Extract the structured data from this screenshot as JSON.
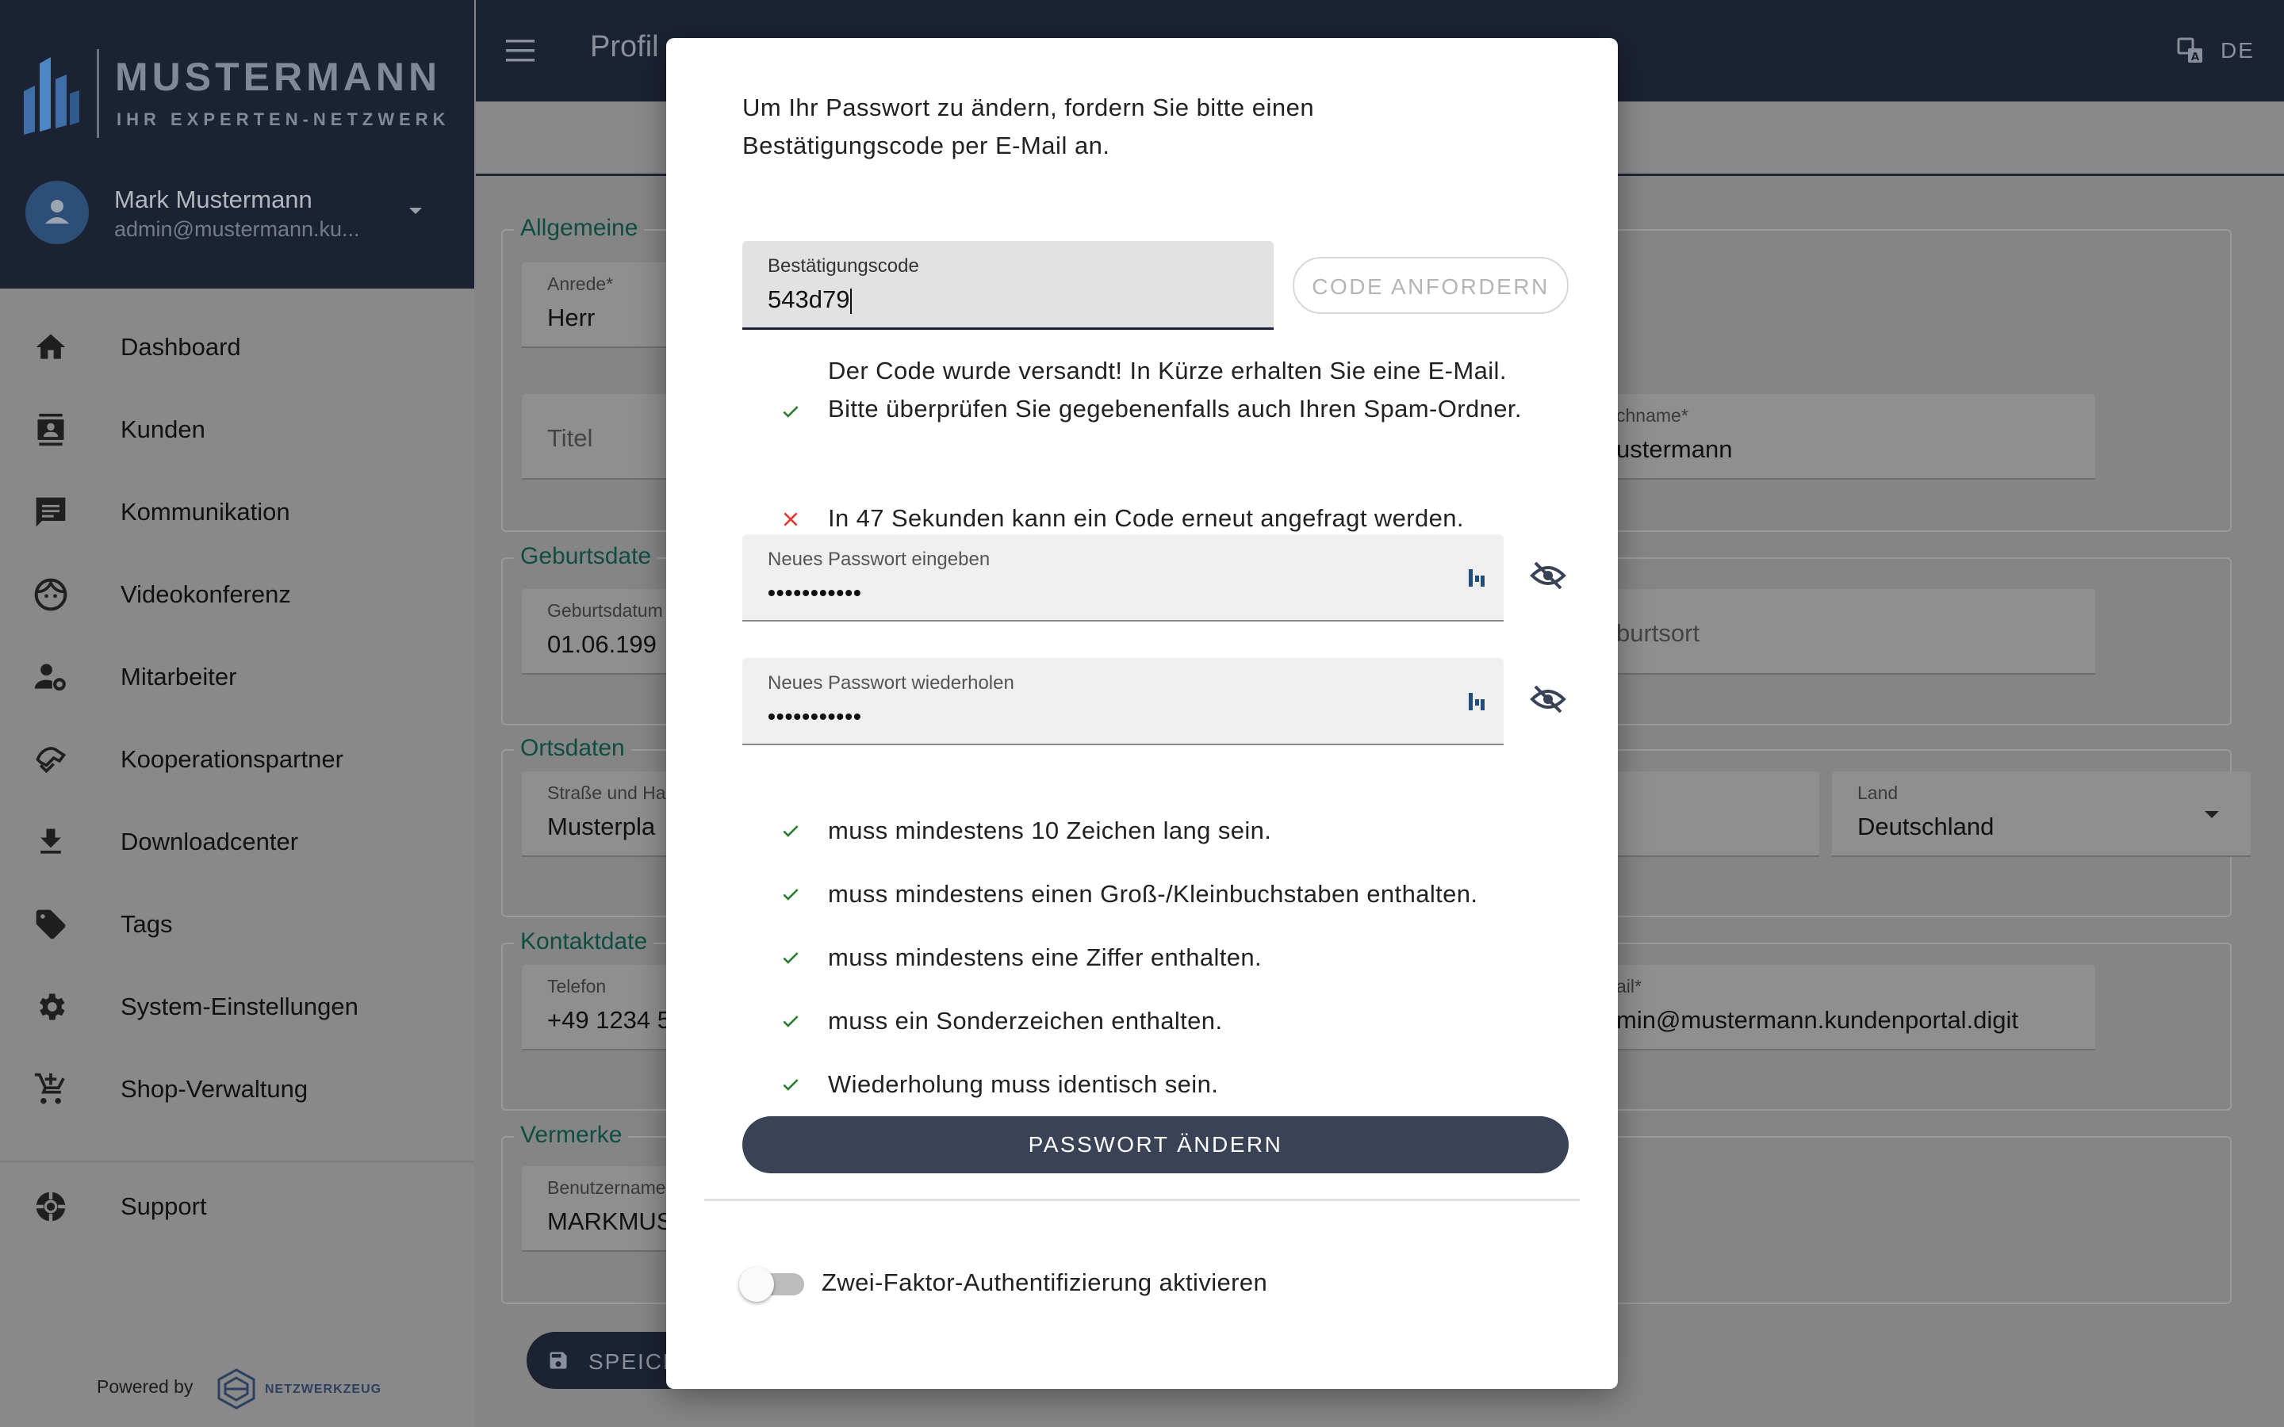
{
  "brand": {
    "name": "MUSTERMANN",
    "tagline": "IHR EXPERTEN-NETZWERK"
  },
  "user": {
    "name": "Mark Mustermann",
    "email": "admin@mustermann.ku..."
  },
  "nav": [
    {
      "label": "Dashboard",
      "icon": "home-icon"
    },
    {
      "label": "Kunden",
      "icon": "contacts-icon"
    },
    {
      "label": "Kommunikation",
      "icon": "chat-icon"
    },
    {
      "label": "Videokonferenz",
      "icon": "face-icon"
    },
    {
      "label": "Mitarbeiter",
      "icon": "user-settings-icon"
    },
    {
      "label": "Kooperationspartner",
      "icon": "handshake-icon"
    },
    {
      "label": "Downloadcenter",
      "icon": "download-icon"
    },
    {
      "label": "Tags",
      "icon": "tag-icon"
    },
    {
      "label": "System-Einstellungen",
      "icon": "gear-icon"
    },
    {
      "label": "Shop-Verwaltung",
      "icon": "cart-add-icon"
    }
  ],
  "support": {
    "label": "Support",
    "icon": "lifebuoy-icon"
  },
  "footer": {
    "powered_by": "Powered by",
    "partner": "NETZWERKZEUG"
  },
  "topbar": {
    "title": "Profil",
    "language": "DE"
  },
  "background_form": {
    "sections": {
      "general": "Allgemeine",
      "birth": "Geburtsdate",
      "location": "Ortsdaten",
      "contact": "Kontaktdate",
      "notes": "Vermerke"
    },
    "fields": {
      "salutation": {
        "label": "Anrede*",
        "value": "Herr"
      },
      "title": {
        "placeholder": "Titel"
      },
      "lastname": {
        "label": "chname*",
        "value": "ustermann"
      },
      "birthdate": {
        "label": "Geburtsdatum",
        "value": "01.06.199"
      },
      "birthplace": {
        "placeholder": "burtsort"
      },
      "street": {
        "label": "Straße und Ha",
        "value": "Musterpla"
      },
      "country": {
        "label": "Land",
        "value": "Deutschland"
      },
      "phone": {
        "label": "Telefon",
        "value": "+49 1234 5"
      },
      "email": {
        "label": "ail*",
        "value": "min@mustermann.kundenportal.digit"
      },
      "username": {
        "label": "Benutzername",
        "value": "MARKMUS"
      }
    },
    "save_label": "SPEICH"
  },
  "modal": {
    "intro": "Um Ihr Passwort zu ändern, fordern Sie bitte einen Bestätigungscode per E-Mail an.",
    "code_field": {
      "label": "Bestätigungscode",
      "value": "543d79"
    },
    "request_code_button": "CODE ANFORDERN",
    "messages": [
      {
        "status": "success",
        "text": "Der Code wurde versandt! In Kürze erhalten Sie eine E-Mail. Bitte überprüfen Sie gegebenenfalls auch Ihren Spam-Ordner."
      },
      {
        "status": "error",
        "text": "In 47 Sekunden kann ein Code erneut angefragt werden."
      }
    ],
    "new_password": {
      "label": "Neues Passwort eingeben",
      "value": "•••••••••••"
    },
    "repeat_password": {
      "label": "Neues Passwort wiederholen",
      "value": "•••••••••••"
    },
    "rules": [
      {
        "ok": true,
        "text": "muss mindestens 10 Zeichen lang sein."
      },
      {
        "ok": true,
        "text": "muss mindestens einen Groß-/Kleinbuchstaben enthalten."
      },
      {
        "ok": true,
        "text": "muss mindestens eine Ziffer enthalten."
      },
      {
        "ok": true,
        "text": "muss ein Sonderzeichen enthalten."
      },
      {
        "ok": true,
        "text": "Wiederholung muss identisch sein."
      }
    ],
    "submit_button": "PASSWORT ÄNDERN",
    "two_factor": {
      "label": "Zwei-Faktor-Authentifizierung aktivieren",
      "enabled": false
    }
  },
  "colors": {
    "navy": "#1b2232",
    "button": "#3a4256",
    "success": "#2e7d32",
    "error": "#e53935",
    "legend": "#0f4d40"
  }
}
